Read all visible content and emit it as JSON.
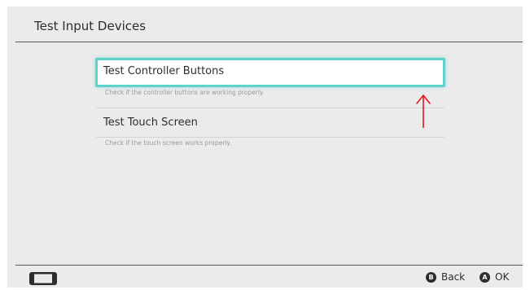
{
  "header": {
    "title": "Test Input Devices"
  },
  "menu": {
    "items": [
      {
        "label": "Test Controller Buttons",
        "description": "Check if the controller buttons are working properly.",
        "selected": true
      },
      {
        "label": "Test Touch Screen",
        "description": "Check if the touch screen works properly.",
        "selected": false
      }
    ]
  },
  "footer": {
    "back": {
      "glyph": "B",
      "label": "Back"
    },
    "ok": {
      "glyph": "A",
      "label": "OK"
    },
    "console_icon": "handheld-console-icon"
  },
  "annotation": {
    "arrow_icon": "up-arrow-icon",
    "color": "#e01818"
  },
  "colors": {
    "background": "#ebebeb",
    "selection_border": "#5fd3ca",
    "text": "#2d2d2d",
    "description_text": "#9a9a9a"
  }
}
